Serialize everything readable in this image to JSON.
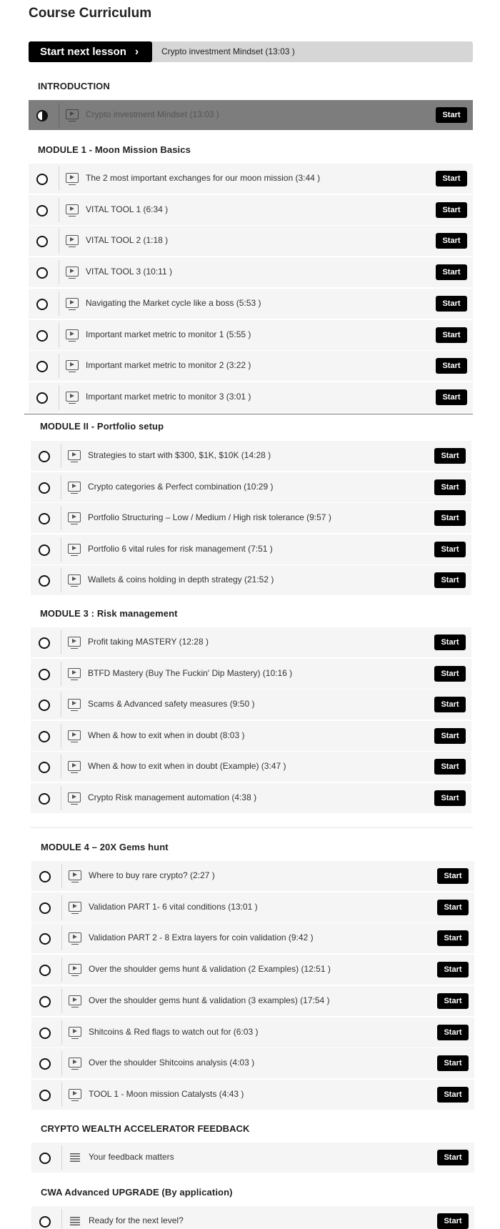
{
  "page": {
    "title": "Course Curriculum"
  },
  "next": {
    "button_label": "Start next lesson",
    "chevron": "›",
    "lesson_title": "Crypto investment Mindset (13:03 )"
  },
  "start_label": "Start",
  "icons": {
    "lesson_icon": "video-icon",
    "feedback_icon": "document-lines-icon",
    "progress_icon": "circle-icon",
    "next_icon": "chevron-right-icon"
  },
  "colors": {
    "button": "#000000",
    "row_bg": "#f5f5f5",
    "active_row_bg": "#7d7d7d",
    "next_bar": "#d6d6d6"
  },
  "sections": [
    {
      "title": "INTRODUCTION",
      "lessons": [
        {
          "title": "Crypto investment Mindset (13:03 )",
          "icon": "video",
          "active": true
        }
      ]
    },
    {
      "title": "MODULE 1 - Moon Mission Basics",
      "lessons": [
        {
          "title": "The 2 most important exchanges for our moon mission (3:44 )",
          "icon": "video"
        },
        {
          "title": "VITAL TOOL 1 (6:34 )",
          "icon": "video"
        },
        {
          "title": "VITAL TOOL 2 (1:18 )",
          "icon": "video"
        },
        {
          "title": "VITAL TOOL 3 (10:11 )",
          "icon": "video"
        },
        {
          "title": "Navigating the Market cycle like a boss (5:53 )",
          "icon": "video"
        },
        {
          "title": "Important market metric to monitor 1 (5:55 )",
          "icon": "video"
        },
        {
          "title": "Important market metric to monitor 2 (3:22 )",
          "icon": "video"
        },
        {
          "title": "Important market metric to monitor 3 (3:01 )",
          "icon": "video"
        }
      ]
    },
    {
      "title": "MODULE II - Portfolio setup",
      "lessons": [
        {
          "title": "Strategies to start with $300, $1K, $10K (14:28 )",
          "icon": "video"
        },
        {
          "title": "Crypto categories & Perfect combination (10:29 )",
          "icon": "video"
        },
        {
          "title": "Portfolio Structuring – Low / Medium / High risk tolerance (9:57 )",
          "icon": "video"
        },
        {
          "title": "Portfolio 6 vital rules for risk management (7:51 )",
          "icon": "video"
        },
        {
          "title": "Wallets & coins holding in depth strategy (21:52 )",
          "icon": "video"
        }
      ]
    },
    {
      "title": "MODULE 3 : Risk management",
      "lessons": [
        {
          "title": "Profit taking MASTERY (12:28 )",
          "icon": "video"
        },
        {
          "title": "BTFD Mastery (Buy The Fuckin' Dip Mastery) (10:16 )",
          "icon": "video"
        },
        {
          "title": "Scams & Advanced safety measures (9:50 )",
          "icon": "video"
        },
        {
          "title": "When & how to exit when in doubt (8:03 )",
          "icon": "video"
        },
        {
          "title": "When & how to exit when in doubt (Example) (3:47 )",
          "icon": "video"
        },
        {
          "title": "Crypto Risk management automation (4:38 )",
          "icon": "video"
        }
      ]
    },
    {
      "title": "MODULE 4 – 20X Gems hunt",
      "lessons": [
        {
          "title": "Where to buy rare crypto? (2:27 )",
          "icon": "video"
        },
        {
          "title": "Validation PART 1- 6 vital conditions (13:01 )",
          "icon": "video"
        },
        {
          "title": "Validation PART 2 - 8 Extra layers for coin validation (9:42 )",
          "icon": "video"
        },
        {
          "title": "Over the shoulder gems hunt & validation (2 Examples) (12:51 )",
          "icon": "video"
        },
        {
          "title": "Over the shoulder gems hunt & validation (3 examples) (17:54 )",
          "icon": "video"
        },
        {
          "title": "Shitcoins & Red flags to watch out for (6:03 )",
          "icon": "video"
        },
        {
          "title": "Over the shoulder Shitcoins analysis (4:03 )",
          "icon": "video"
        },
        {
          "title": "TOOL 1 - Moon mission Catalysts (4:43 )",
          "icon": "video"
        }
      ]
    },
    {
      "title": "CRYPTO WEALTH ACCELERATOR FEEDBACK",
      "lessons": [
        {
          "title": "Your feedback matters",
          "icon": "doc"
        }
      ]
    },
    {
      "title": "CWA Advanced UPGRADE (By application)",
      "lessons": [
        {
          "title": "Ready for the next level?",
          "icon": "doc"
        }
      ]
    }
  ]
}
